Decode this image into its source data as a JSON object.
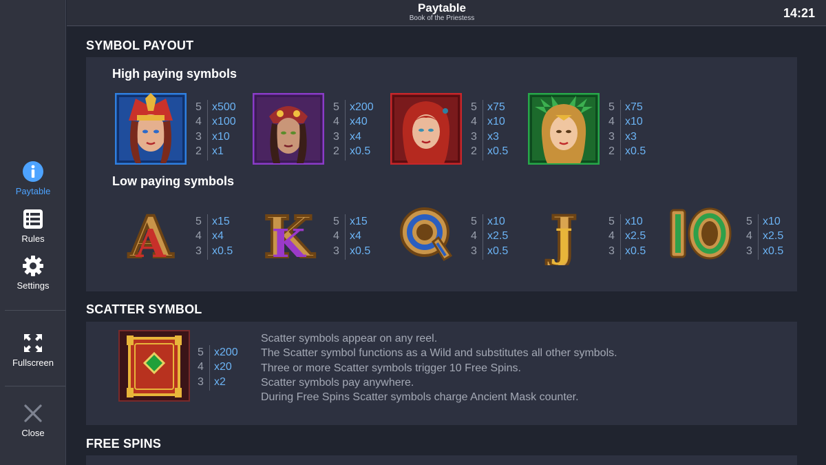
{
  "header": {
    "title": "Paytable",
    "subtitle": "Book of the Priestess",
    "clock": "14:21"
  },
  "sidebar": {
    "paytable": "Paytable",
    "rules": "Rules",
    "settings": "Settings",
    "fullscreen": "Fullscreen",
    "close": "Close"
  },
  "colors": {
    "accent": "#4da3ff",
    "multiplier": "#6cb4f5",
    "panel": "#2d3140",
    "background": "#20242f"
  },
  "symbol_payout": {
    "title": "SYMBOL PAYOUT",
    "high_title": "High paying symbols",
    "high": [
      {
        "icon": "blue-priestess-symbol",
        "pays": [
          {
            "count": "5",
            "mult": "x500"
          },
          {
            "count": "4",
            "mult": "x100"
          },
          {
            "count": "3",
            "mult": "x10"
          },
          {
            "count": "2",
            "mult": "x1"
          }
        ]
      },
      {
        "icon": "purple-priestess-symbol",
        "pays": [
          {
            "count": "5",
            "mult": "x200"
          },
          {
            "count": "4",
            "mult": "x40"
          },
          {
            "count": "3",
            "mult": "x4"
          },
          {
            "count": "2",
            "mult": "x0.5"
          }
        ]
      },
      {
        "icon": "red-priestess-symbol",
        "pays": [
          {
            "count": "5",
            "mult": "x75"
          },
          {
            "count": "4",
            "mult": "x10"
          },
          {
            "count": "3",
            "mult": "x3"
          },
          {
            "count": "2",
            "mult": "x0.5"
          }
        ]
      },
      {
        "icon": "green-priestess-symbol",
        "pays": [
          {
            "count": "5",
            "mult": "x75"
          },
          {
            "count": "4",
            "mult": "x10"
          },
          {
            "count": "3",
            "mult": "x3"
          },
          {
            "count": "2",
            "mult": "x0.5"
          }
        ]
      }
    ],
    "low_title": "Low paying symbols",
    "low": [
      {
        "letter": "A",
        "icon": "letter-a-symbol",
        "pays": [
          {
            "count": "5",
            "mult": "x15"
          },
          {
            "count": "4",
            "mult": "x4"
          },
          {
            "count": "3",
            "mult": "x0.5"
          }
        ]
      },
      {
        "letter": "K",
        "icon": "letter-k-symbol",
        "pays": [
          {
            "count": "5",
            "mult": "x15"
          },
          {
            "count": "4",
            "mult": "x4"
          },
          {
            "count": "3",
            "mult": "x0.5"
          }
        ]
      },
      {
        "letter": "Q",
        "icon": "letter-q-symbol",
        "pays": [
          {
            "count": "5",
            "mult": "x10"
          },
          {
            "count": "4",
            "mult": "x2.5"
          },
          {
            "count": "3",
            "mult": "x0.5"
          }
        ]
      },
      {
        "letter": "J",
        "icon": "letter-j-symbol",
        "pays": [
          {
            "count": "5",
            "mult": "x10"
          },
          {
            "count": "4",
            "mult": "x2.5"
          },
          {
            "count": "3",
            "mult": "x0.5"
          }
        ]
      },
      {
        "letter": "10",
        "icon": "number-10-symbol",
        "pays": [
          {
            "count": "5",
            "mult": "x10"
          },
          {
            "count": "4",
            "mult": "x2.5"
          },
          {
            "count": "3",
            "mult": "x0.5"
          }
        ]
      }
    ]
  },
  "scatter": {
    "title": "SCATTER SYMBOL",
    "icon": "book-scatter-symbol",
    "pays": [
      {
        "count": "5",
        "mult": "x200"
      },
      {
        "count": "4",
        "mult": "x20"
      },
      {
        "count": "3",
        "mult": "x2"
      }
    ],
    "lines": [
      "Scatter symbols appear on any reel.",
      "The Scatter symbol functions as a Wild and substitutes all other symbols.",
      "Three or more Scatter symbols trigger 10 Free Spins.",
      "Scatter symbols pay anywhere.",
      "During Free Spins Scatter symbols charge Ancient Mask counter."
    ]
  },
  "free_spins": {
    "title": "FREE SPINS"
  }
}
